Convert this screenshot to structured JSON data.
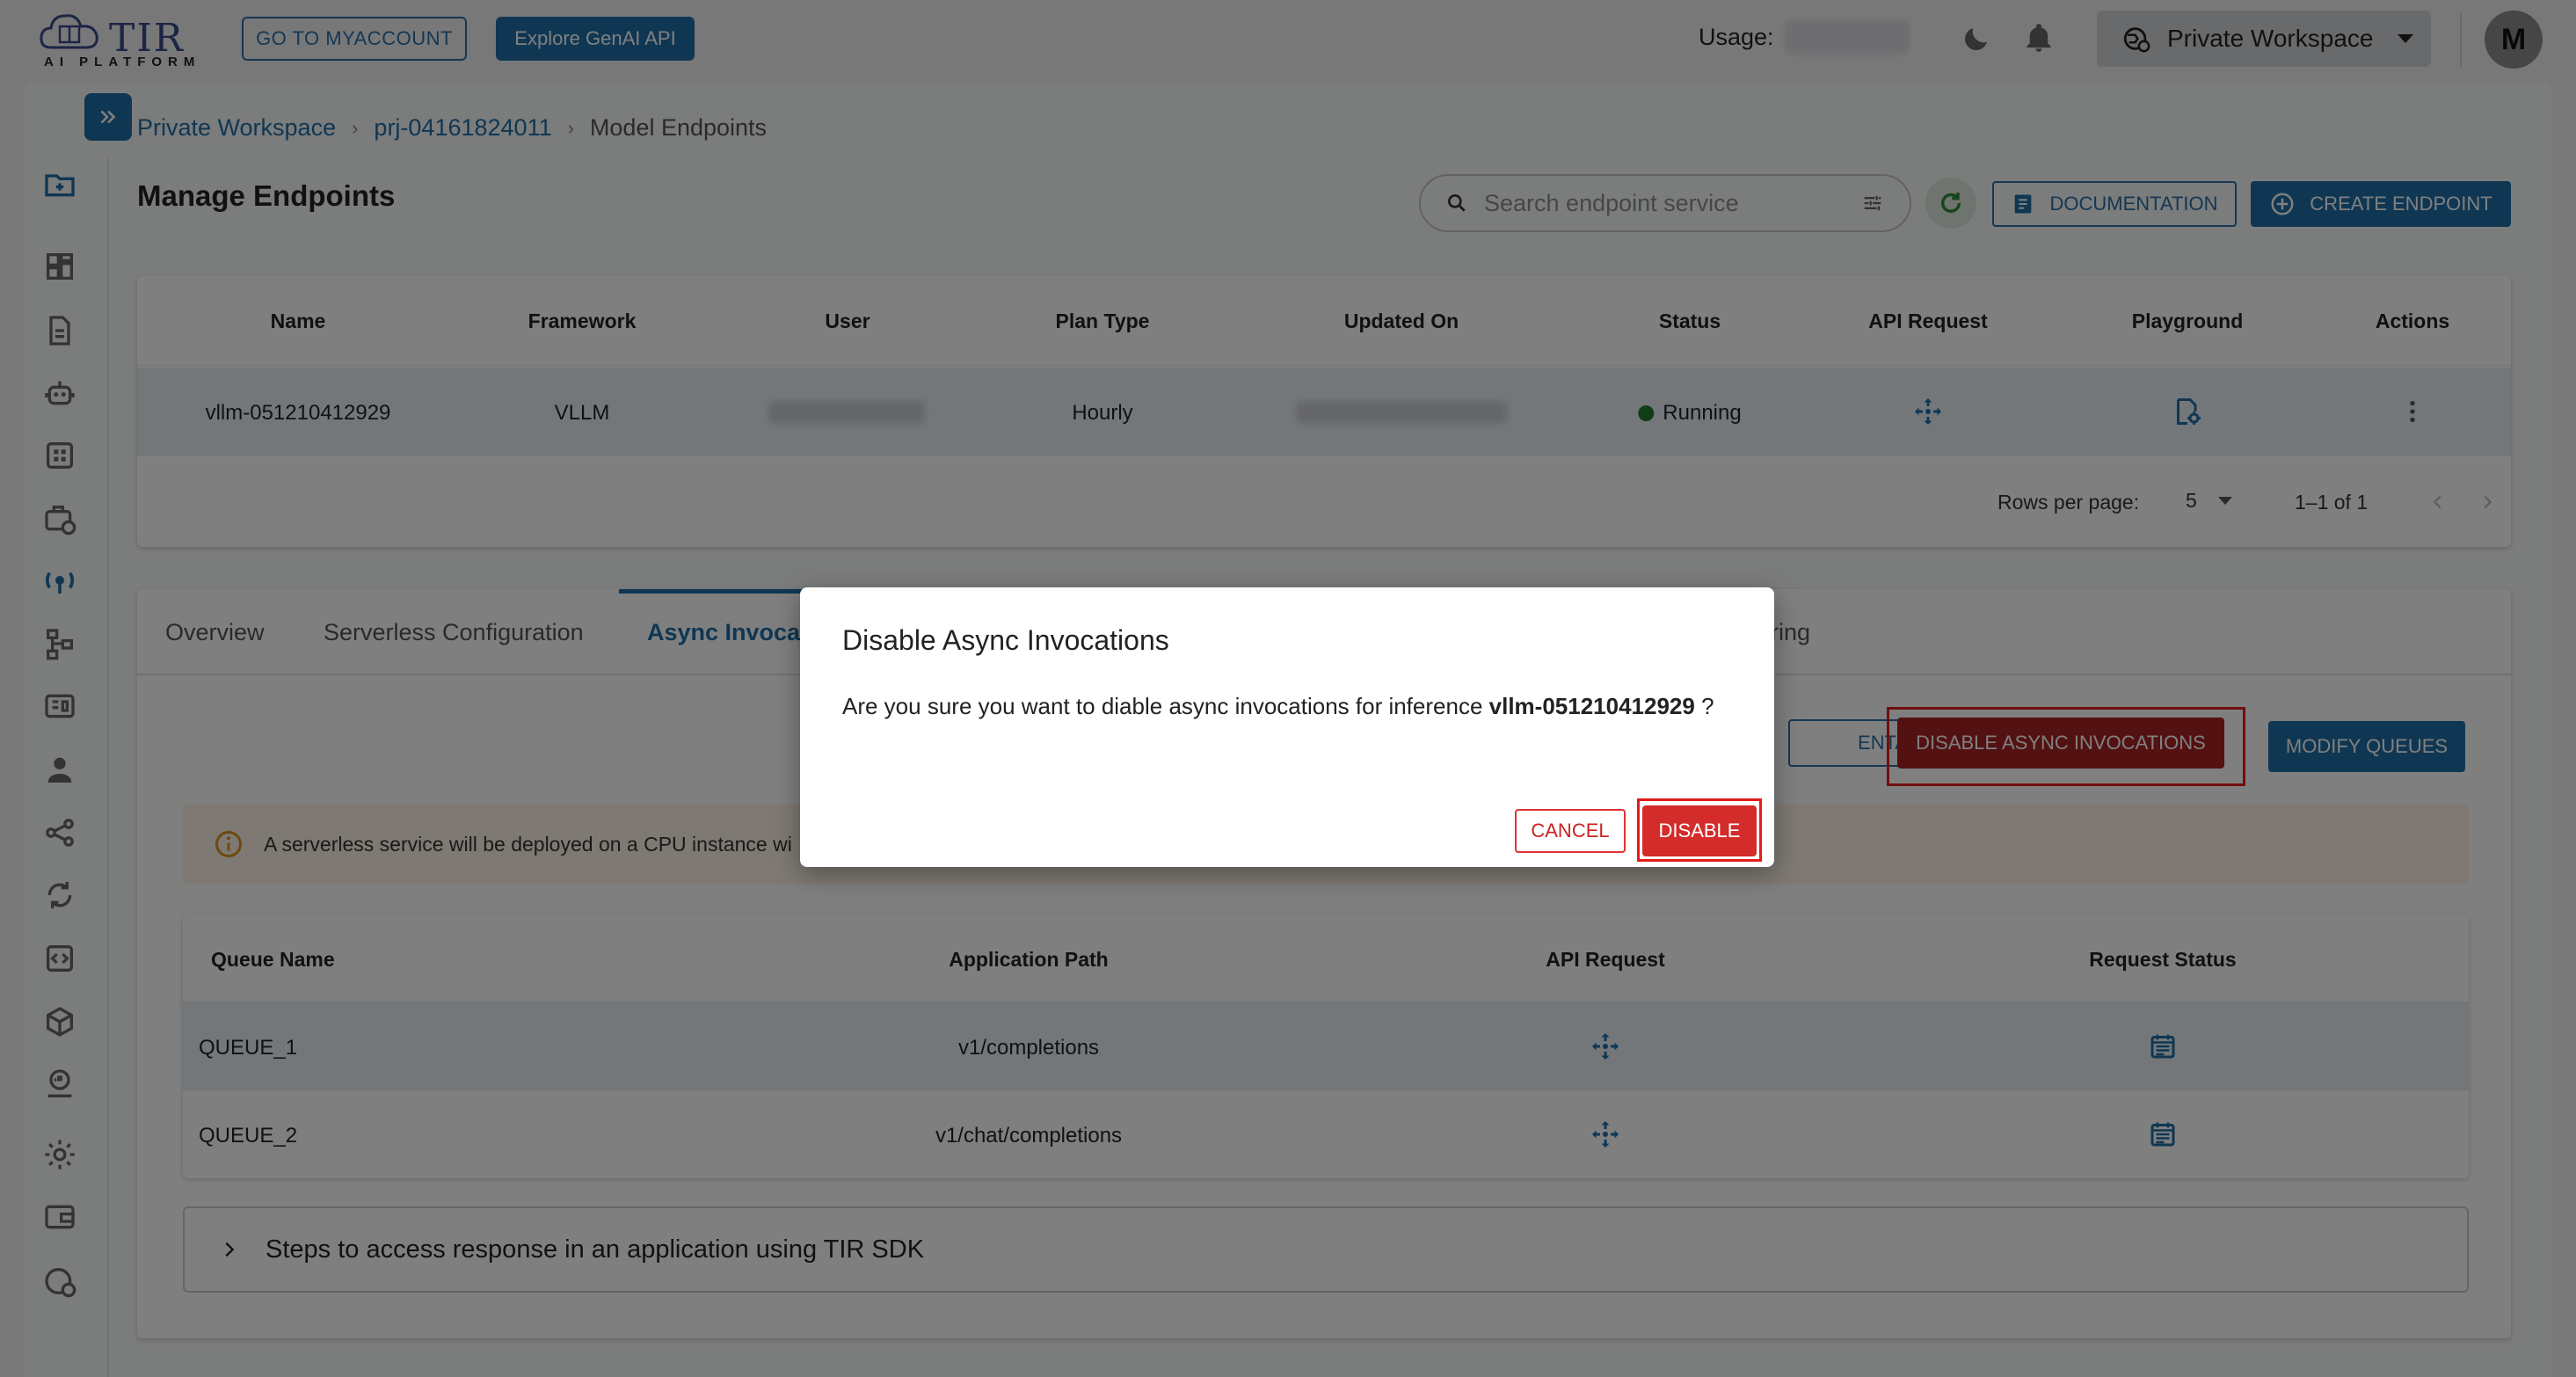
{
  "header": {
    "logo_text": "TIR",
    "logo_sub": "AI PLATFORM",
    "myaccount_label": "GO TO MYACCOUNT",
    "genai_label": "Explore GenAI API",
    "usage_label": "Usage:",
    "workspace_label": "Private Workspace",
    "avatar_initial": "M"
  },
  "breadcrumb": [
    "Private Workspace",
    "prj-04161824011",
    "Model Endpoints"
  ],
  "page_title": "Manage Endpoints",
  "search": {
    "placeholder": "Search endpoint service"
  },
  "toolbar": {
    "documentation_label": "DOCUMENTATION",
    "create_label": "CREATE ENDPOINT"
  },
  "endpoints_table": {
    "columns": [
      "Name",
      "Framework",
      "User",
      "Plan Type",
      "Updated On",
      "Status",
      "API Request",
      "Playground",
      "Actions"
    ],
    "rows": [
      {
        "name": "vllm-051210412929",
        "framework": "VLLM",
        "plan_type": "Hourly",
        "status": "Running"
      }
    ],
    "rows_per_page_label": "Rows per page:",
    "rows_per_page": "5",
    "range": "1–1 of 1"
  },
  "detail": {
    "tabs": [
      "Overview",
      "Serverless Configuration",
      "Async Invoca",
      "ring"
    ],
    "documentation_label": "ENTATION",
    "disable_async_label": "DISABLE ASYNC INVOCATIONS",
    "modify_queues_label": "MODIFY QUEUES",
    "info_text": "A serverless service will be deployed on a CPU instance wi",
    "queue_table": {
      "columns": [
        "Queue Name",
        "Application Path",
        "API Request",
        "Request Status"
      ],
      "rows": [
        {
          "queue": "QUEUE_1",
          "path": "v1/completions"
        },
        {
          "queue": "QUEUE_2",
          "path": "v1/chat/completions"
        }
      ]
    },
    "sdk_label": "Steps to access response in an application using TIR SDK"
  },
  "modal": {
    "title": "Disable Async Invocations",
    "body_prefix": "Are you sure you want to diable async invocations for inference",
    "body_name": "vllm-051210412929",
    "body_suffix": "?",
    "cancel_label": "CANCEL",
    "disable_label": "DISABLE"
  },
  "colors": {
    "primary": "#1e6fa6",
    "danger": "#d42b2b",
    "running": "#1f7a2e",
    "highlight_border": "#e21c1c"
  }
}
